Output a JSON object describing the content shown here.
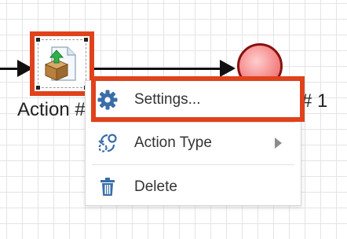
{
  "canvas": {
    "action_node_label": "Action #",
    "end_node_label": "# 1"
  },
  "context_menu": {
    "items": [
      {
        "label": "Settings...",
        "icon": "gear-icon",
        "highlighted": true
      },
      {
        "label": "Action Type",
        "icon": "action-type-icon",
        "has_submenu": true
      },
      {
        "label": "Delete",
        "icon": "trash-icon"
      }
    ]
  },
  "colors": {
    "highlight": "#e0421c",
    "end_event_fill": "#f58c8c",
    "end_event_border": "#8b1010",
    "icon_blue": "#3a6da8"
  }
}
